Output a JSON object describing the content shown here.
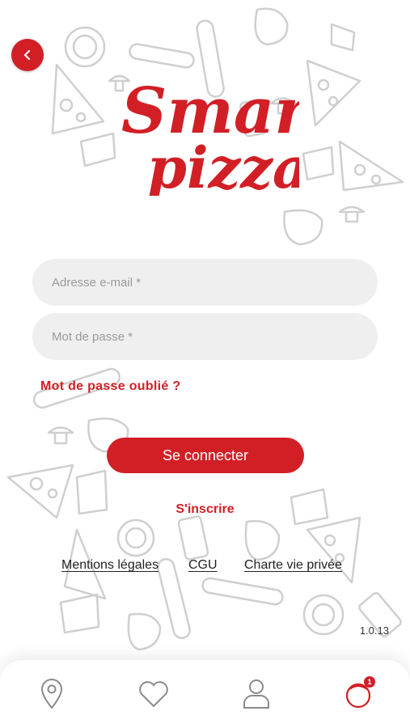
{
  "header": {
    "back_icon": "chevron-left-icon"
  },
  "logo": {
    "line1": "Smart",
    "line2": "pizza"
  },
  "form": {
    "email_placeholder": "Adresse e-mail *",
    "email_value": "",
    "password_placeholder": "Mot de passe *",
    "password_value": "",
    "forgot_label": "Mot de passe oublié ?",
    "connect_label": "Se connecter",
    "signup_label": "S'inscrire"
  },
  "legal": {
    "mentions": "Mentions légales",
    "cgu": "CGU",
    "privacy": "Charte vie privée"
  },
  "version": "1.0.13",
  "nav": {
    "items": [
      {
        "icon": "location-pin-icon"
      },
      {
        "icon": "heart-icon"
      },
      {
        "icon": "user-icon"
      },
      {
        "icon": "cart-icon",
        "badge": "1"
      }
    ]
  },
  "colors": {
    "accent": "#d21f26",
    "field_bg": "#efefef",
    "doodle": "#c8c8c8"
  }
}
